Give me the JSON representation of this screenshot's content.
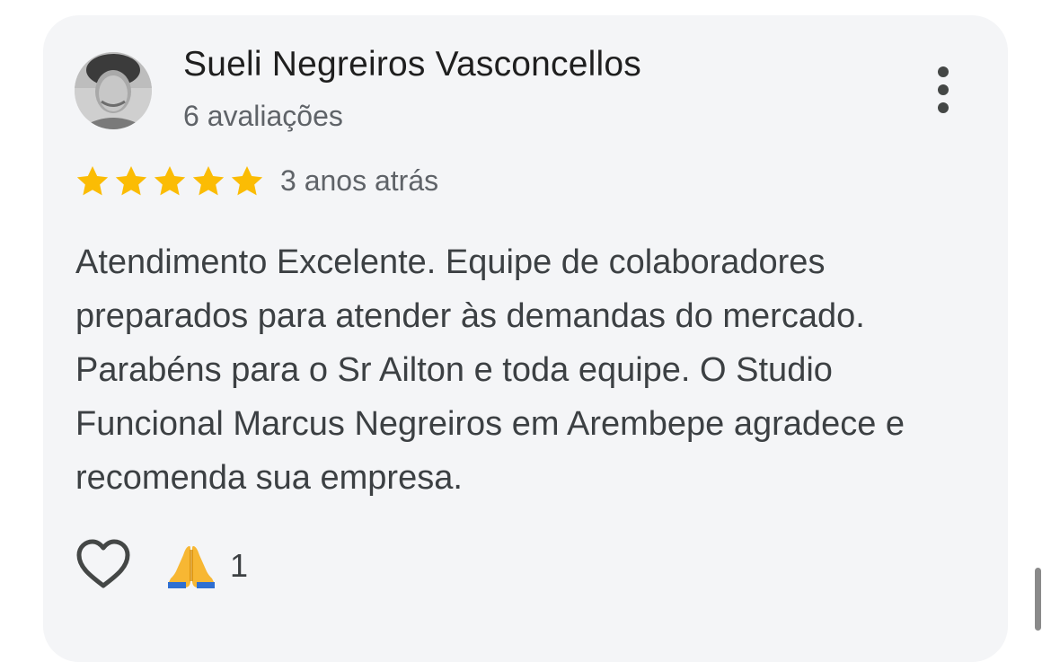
{
  "review": {
    "author_name": "Sueli Negreiros Vasconcellos",
    "author_reviews": "6 avaliações",
    "rating": 5,
    "rating_max": 5,
    "time_ago": "3 anos atrás",
    "text": "Atendimento Excelente. Equipe de colaboradores preparados para atender às demandas do mercado. Parabéns para o Sr Ailton e toda equipe. O Studio Funcional Marcus Negreiros em Arembepe agradece e recomenda sua empresa."
  },
  "reactions": {
    "like_icon": "heart-outline-icon",
    "reaction_icon": "folded-hands-icon",
    "reaction_count": "1"
  },
  "icons": {
    "menu": "more-vertical-icon",
    "star": "star-icon"
  },
  "colors": {
    "card_background": "#f4f5f7",
    "star": "#fbbc04",
    "primary_text": "#1f1f1f",
    "secondary_text": "#5f6368"
  }
}
